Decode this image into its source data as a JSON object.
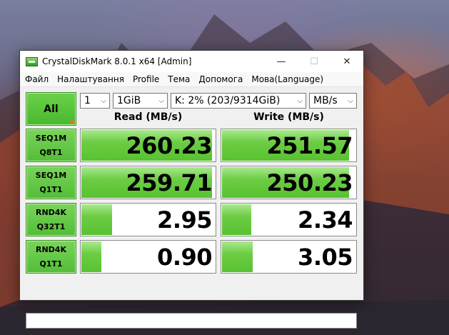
{
  "window": {
    "title": "CrystalDiskMark 8.0.1 x64 [Admin]",
    "minimize": "—",
    "maximize": "☐",
    "close": "✕"
  },
  "menu": [
    "Файл",
    "Налаштування",
    "Profile",
    "Тема",
    "Допомога",
    "Мова(Language)"
  ],
  "controls": {
    "all_label": "All",
    "count": "1",
    "size": "1GiB",
    "drive": "K: 2% (203/9314GiB)",
    "unit": "MB/s"
  },
  "headers": {
    "read": "Read (MB/s)",
    "write": "Write (MB/s)"
  },
  "tests": [
    {
      "line1": "SEQ1M",
      "line2": "Q8T1",
      "read": "260.23",
      "write": "251.57",
      "read_fill": 0.98,
      "write_fill": 0.95
    },
    {
      "line1": "SEQ1M",
      "line2": "Q1T1",
      "read": "259.71",
      "write": "250.23",
      "read_fill": 0.98,
      "write_fill": 0.95
    },
    {
      "line1": "RND4K",
      "line2": "Q32T1",
      "read": "2.95",
      "write": "2.34",
      "read_fill": 0.24,
      "write_fill": 0.23
    },
    {
      "line1": "RND4K",
      "line2": "Q1T1",
      "read": "0.90",
      "write": "3.05",
      "read_fill": 0.16,
      "write_fill": 0.24
    }
  ],
  "status_text": "",
  "colors": {
    "bar_green": "#58c231",
    "button_green": "#53bd37",
    "accent_orange": "#e8752a"
  }
}
